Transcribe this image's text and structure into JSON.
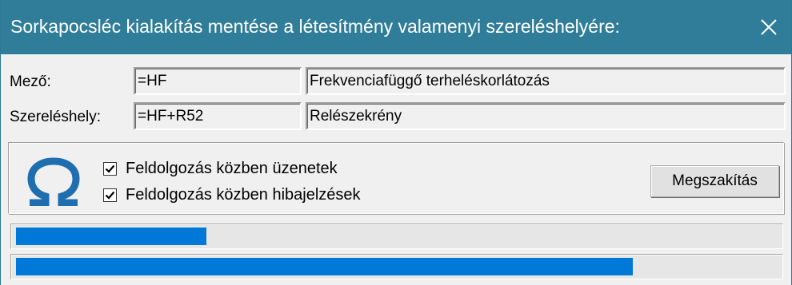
{
  "window": {
    "title": "Sorkapocsléc kialakítás mentése a létesítmény valamenyi szereléshelyére:",
    "close_icon": "close-icon"
  },
  "fields": {
    "mezo": {
      "label": "Mező:",
      "code": "=HF",
      "description": "Frekvenciafüggő terheléskorlátozás"
    },
    "szerelehely": {
      "label": "Szereléshely:",
      "code": "=HF+R52",
      "description": "Relészekrény"
    }
  },
  "options": {
    "icon": "omega-icon",
    "messages": {
      "label": "Feldolgozás közben üzenetek",
      "checked": true
    },
    "errors": {
      "label": "Feldolgozás közben hibajelzések",
      "checked": true
    }
  },
  "buttons": {
    "abort_label": "Megszakítás"
  },
  "progress": {
    "bar1_fraction": 0.25,
    "bar2_fraction": 0.81
  },
  "colors": {
    "titlebar": "#2f7d99",
    "progress_fill": "#0078d7",
    "omega_icon": "#1f6eb0"
  }
}
